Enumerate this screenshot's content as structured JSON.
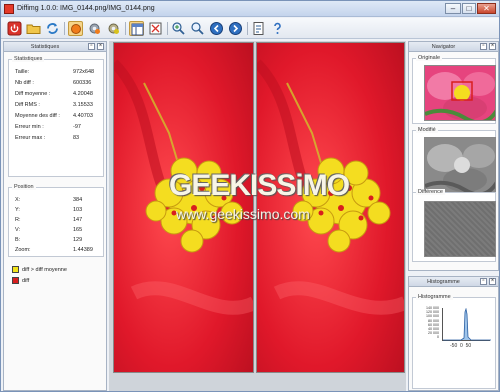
{
  "window": {
    "title": "Diffimg 1.0.0: IMG_0144.png/IMG_0144.png",
    "minimize": "–",
    "maximize": "□",
    "close": "✕"
  },
  "toolbar": {
    "icons": [
      "power-icon",
      "open-folder-icon",
      "refresh-icon",
      "orange-circle-icon",
      "gear-icon",
      "settings-gear-icon",
      "layout-icon",
      "compare-icon",
      "zoom-fit-icon",
      "zoom-icon",
      "previous-icon",
      "next-icon",
      "next-end-icon",
      "checklist-icon",
      "help-icon"
    ]
  },
  "stats_panel": {
    "title": "Statistiques",
    "stats_group": "Statistiques",
    "stats": [
      {
        "label": "Taille:",
        "value": "972x648"
      },
      {
        "label": "Nb diff :",
        "value": "600336"
      },
      {
        "label": "Diff moyenne :",
        "value": "4.20048"
      },
      {
        "label": "Diff RMS :",
        "value": "3.15533"
      },
      {
        "label": "Moyenne des diff :",
        "value": "4.40703"
      },
      {
        "label": "Erreur min :",
        "value": "-97"
      },
      {
        "label": "Erreur max :",
        "value": "83"
      }
    ],
    "position_group": "Position",
    "position": [
      {
        "label": "X:",
        "value": "384"
      },
      {
        "label": "Y:",
        "value": "103"
      },
      {
        "label": "R:",
        "value": "147"
      },
      {
        "label": "V:",
        "value": "165"
      },
      {
        "label": "B:",
        "value": "129"
      },
      {
        "label": "Zoom:",
        "value": "1.44389"
      }
    ],
    "legend": [
      {
        "label": "diff > diff moyenne",
        "color": "#f2e31a"
      },
      {
        "label": "diff",
        "color": "#d81e1e"
      }
    ]
  },
  "navigator_panel": {
    "title": "Navigator",
    "original_label": "Originale",
    "modified_label": "Modifié",
    "difference_label": "Différence"
  },
  "histogram_panel": {
    "title": "Histogramme",
    "group_label": "Histogramme",
    "y_ticks": [
      "140 000",
      "120 000",
      "100 000",
      "80 000",
      "60 000",
      "40 000",
      "20 000",
      "0"
    ],
    "x_ticks": [
      "-50",
      "0",
      "50"
    ]
  },
  "watermark": {
    "brand": "GEEKISSiMO",
    "url": "www.geekissimo.com"
  },
  "colors": {
    "petal_red": "#e01b2a",
    "pollen_yellow": "#f4dd20",
    "chrome_blue": "#c4d4ec"
  }
}
